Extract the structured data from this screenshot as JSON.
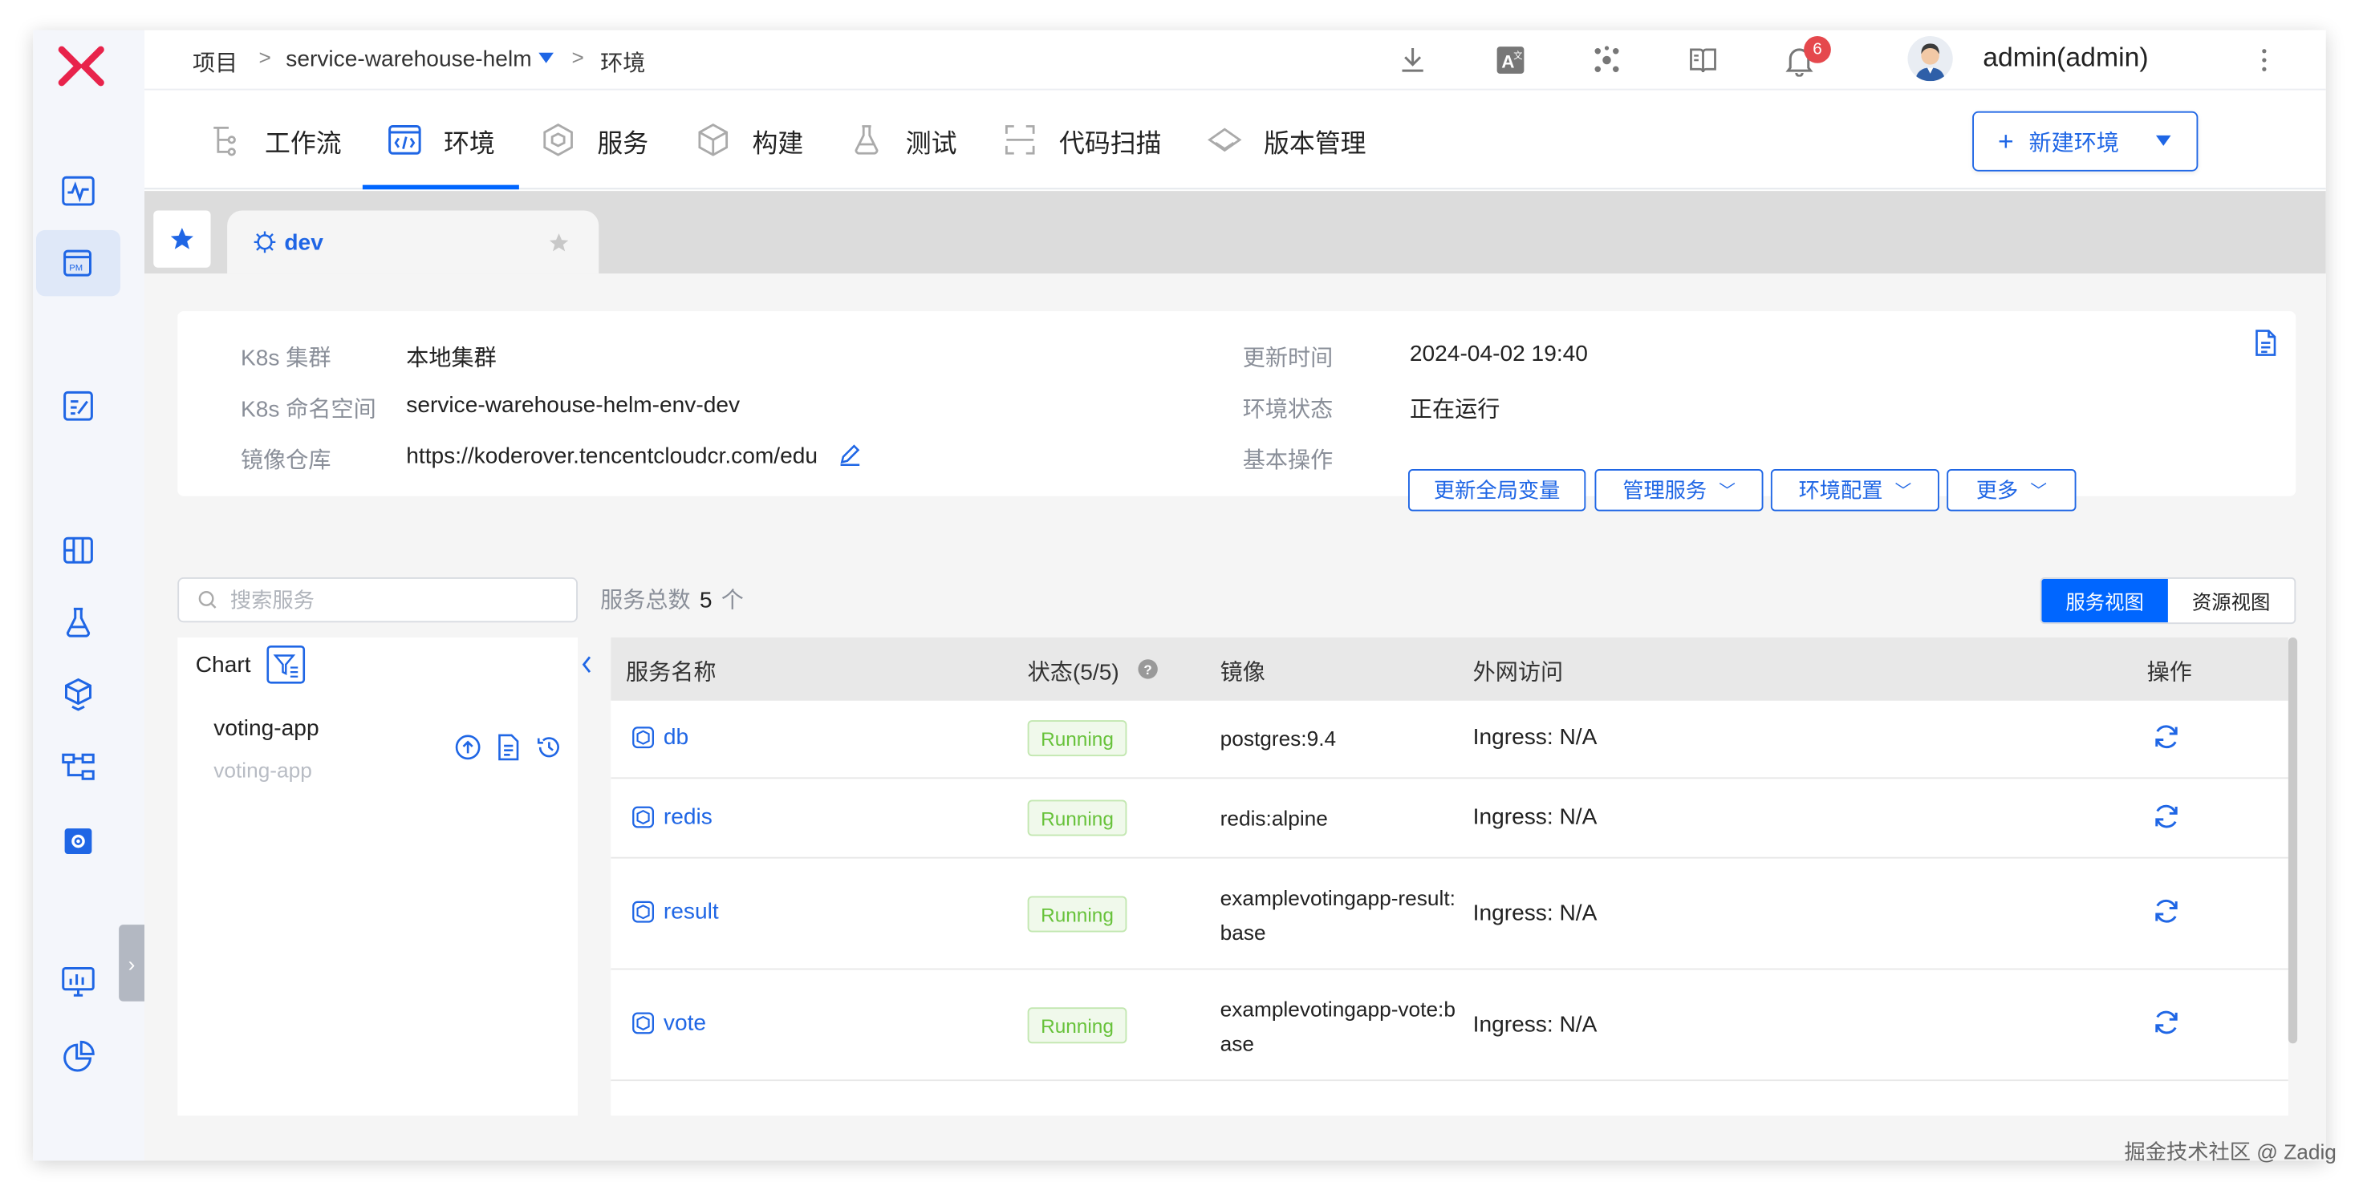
{
  "breadcrumb": {
    "root": "项目",
    "project": "service-warehouse-helm",
    "current": "环境",
    "sep": ">"
  },
  "notifications": {
    "count": "6"
  },
  "user": {
    "name": "admin(admin)"
  },
  "tabs": [
    {
      "label": "工作流",
      "icon": "workflow-icon"
    },
    {
      "label": "环境",
      "icon": "code-icon"
    },
    {
      "label": "服务",
      "icon": "service-icon"
    },
    {
      "label": "构建",
      "icon": "build-icon"
    },
    {
      "label": "测试",
      "icon": "flask-icon"
    },
    {
      "label": "代码扫描",
      "icon": "scan-icon"
    },
    {
      "label": "版本管理",
      "icon": "version-icon"
    }
  ],
  "new_env_label": "新建环境",
  "env_tab": {
    "name": "dev"
  },
  "info": {
    "cluster_label": "K8s 集群",
    "cluster_value": "本地集群",
    "namespace_label": "K8s 命名空间",
    "namespace_value": "service-warehouse-helm-env-dev",
    "registry_label": "镜像仓库",
    "registry_value": "https://koderover.tencentcloudcr.com/edu",
    "updated_label": "更新时间",
    "updated_value": "2024-04-02 19:40",
    "status_label": "环境状态",
    "status_value": "正在运行",
    "ops_label": "基本操作"
  },
  "ops": {
    "update_vars": "更新全局变量",
    "manage": "管理服务",
    "config": "环境配置",
    "more": "更多"
  },
  "search": {
    "placeholder": "搜索服务"
  },
  "total": {
    "label": "服务总数",
    "count": "5",
    "unit": "个"
  },
  "views": {
    "service": "服务视图",
    "resource": "资源视图"
  },
  "chart_panel": {
    "title": "Chart",
    "app": "voting-app",
    "sub": "voting-app"
  },
  "table": {
    "headers": {
      "name": "服务名称",
      "status": "状态(5/5)",
      "image": "镜像",
      "ingress": "外网访问",
      "ops": "操作"
    },
    "rows": [
      {
        "name": "db",
        "status": "Running",
        "image": "postgres:9.4",
        "ingress": "Ingress: N/A"
      },
      {
        "name": "redis",
        "status": "Running",
        "image": "redis:alpine",
        "ingress": "Ingress: N/A"
      },
      {
        "name": "result",
        "status": "Running",
        "image": "examplevotingapp-result:base",
        "ingress": "Ingress: N/A"
      },
      {
        "name": "vote",
        "status": "Running",
        "image": "examplevotingapp-vote:base",
        "ingress": "Ingress: N/A"
      }
    ]
  },
  "watermark": "掘金技术社区 @ Zadig",
  "colors": {
    "accent": "#0066ff",
    "running": "#67c23a",
    "brand": "#e8234b",
    "badge": "#e5484d"
  }
}
